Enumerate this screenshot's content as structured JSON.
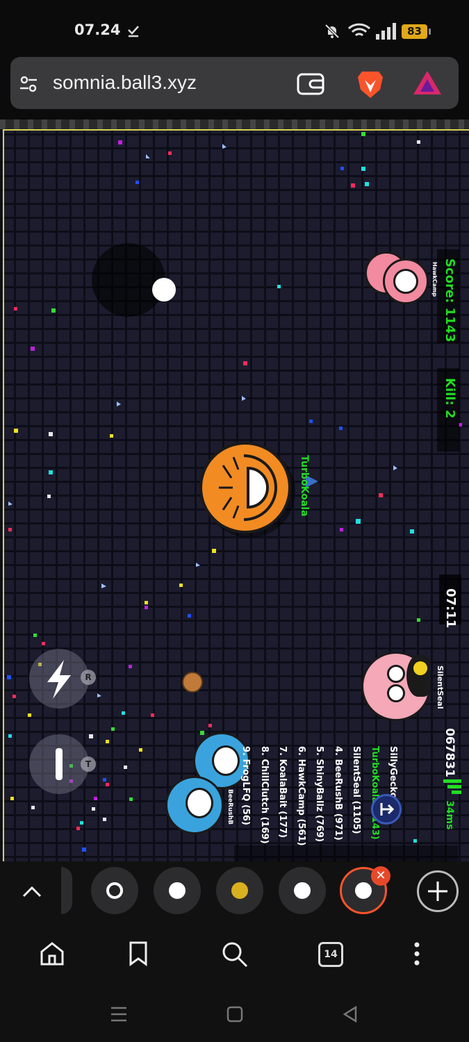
{
  "status_bar": {
    "time": "07.24",
    "battery": "83"
  },
  "browser": {
    "url": "somnia.ball3.xyz",
    "tab_count": "14"
  },
  "hud": {
    "score": "Score: 1143",
    "kill": "Kill: 2",
    "timer": "07:11",
    "points": "067831",
    "ping": "34ms"
  },
  "players": {
    "self_name": "TurboKoala",
    "hawk_name": "HawkCamp",
    "seal_name": "SilentSeal",
    "bottom_name": "BeeRushB"
  },
  "leaderboard": [
    "SillyGecko (",
    "TurboKoala (1143)",
    "SilentSeal (1105)",
    "4. BeeRushB (971)",
    "5. ShinyBallz (769)",
    "6. HawkCamp (561)",
    "7. KoalaBait (177)",
    "8. ChillClutch (169)",
    "9. FrogLFQ (56)"
  ],
  "controls": {
    "boost_key": "R",
    "split_key": "T"
  },
  "colors": {
    "grid_bg": "#1c1c2e",
    "grid_line": "#0d0d18",
    "hud_green": "#22dd22",
    "self_orange": "#f28b22",
    "pink": "#f28aa0",
    "blue": "#3aa3dd",
    "brave_orange": "#fb542b"
  }
}
